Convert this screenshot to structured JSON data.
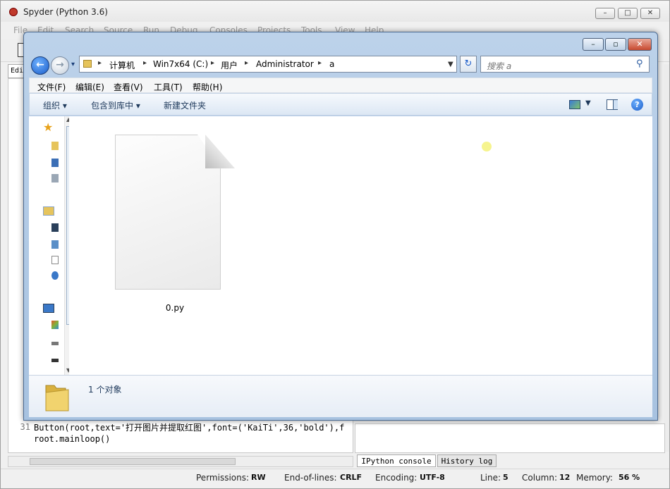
{
  "spyder": {
    "title": "Spyder (Python 3.6)",
    "menu": [
      "File",
      "Edit",
      "Search",
      "Source",
      "Run",
      "Debug",
      "Consoles",
      "Projects",
      "Tools",
      "View",
      "Help"
    ],
    "editor_tab": "Edi",
    "code": [
      {
        "no": "31",
        "text": "Button(root,text='打开图片并提取红图',font=('KaiTi',36,'bold'),f"
      },
      {
        "no": "",
        "text": "root.mainloop()"
      }
    ],
    "console_tabs": [
      "IPython console",
      "History log"
    ],
    "status": {
      "permissions_label": "Permissions:",
      "permissions": "RW",
      "eol_label": "End-of-lines:",
      "eol": "CRLF",
      "encoding_label": "Encoding:",
      "encoding": "UTF-8",
      "line_label": "Line:",
      "line": "5",
      "column_label": "Column:",
      "column": "12",
      "memory_label": "Memory:",
      "memory": "56 %"
    }
  },
  "explorer": {
    "breadcrumbs": [
      "计算机",
      "Win7x64 (C:)",
      "用户",
      "Administrator",
      "a"
    ],
    "search_placeholder": "搜索 a",
    "menu": [
      "文件(F)",
      "编辑(E)",
      "查看(V)",
      "工具(T)",
      "帮助(H)"
    ],
    "commands": {
      "organize": "组织 ▾",
      "include_library": "包含到库中 ▾",
      "new_folder": "新建文件夹"
    },
    "files": [
      {
        "name": "0.py",
        "icon": "blank-file-icon"
      }
    ],
    "details": {
      "count": "1 个对象"
    }
  }
}
